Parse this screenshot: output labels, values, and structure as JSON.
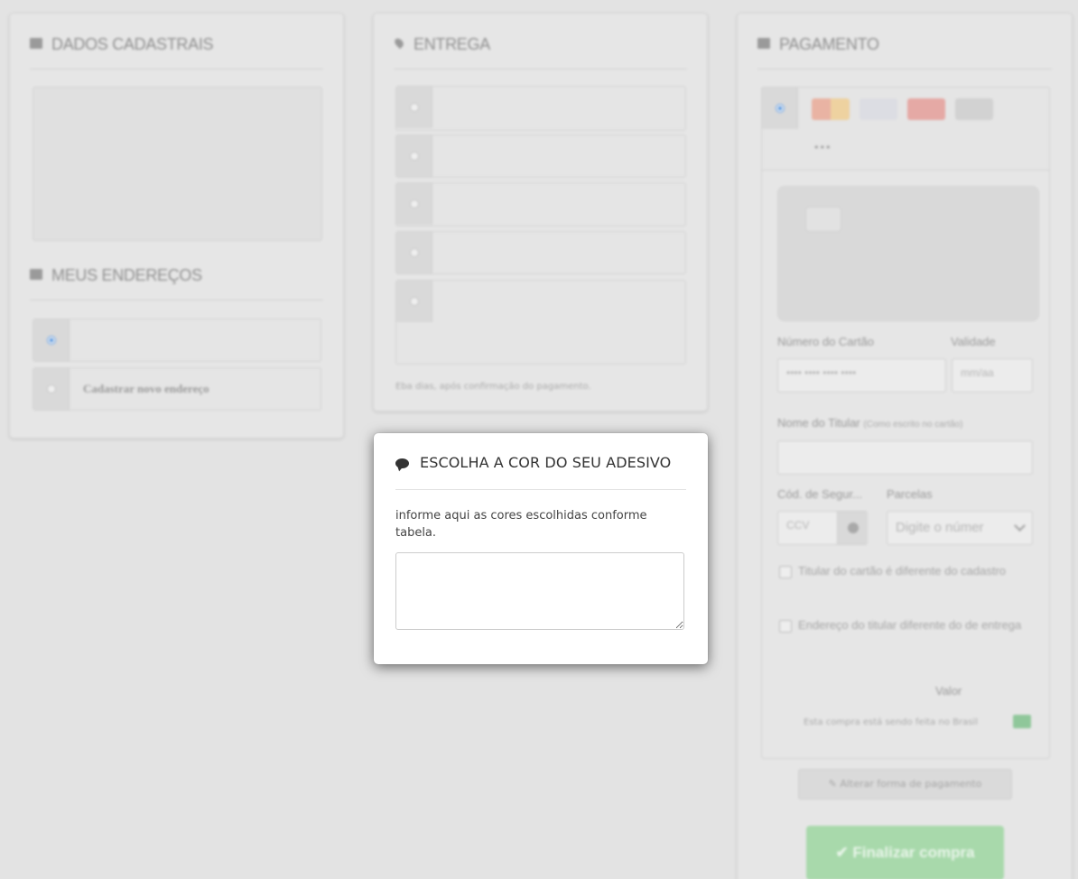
{
  "dados": {
    "title": "DADOS CADASTRAIS",
    "enderecos_title": "MEUS ENDEREÇOS",
    "new_address_label": "Cadastrar novo endereço"
  },
  "entrega": {
    "title": "ENTREGA",
    "options_count": 5,
    "note": "Eba dias, após confirmação do pagamento."
  },
  "pagamento": {
    "title": "PAGAMENTO",
    "brands": [
      "mastercard-icon",
      "visa-icon",
      "amex-icon",
      "diners-icon"
    ],
    "more_label": "•••",
    "card_number_label": "Número do Cartão",
    "card_number_placeholder": "•••• •••• •••• ••••",
    "validity_label": "Validade",
    "validity_placeholder": "mm/aa",
    "holder_label": "Nome do Titular",
    "holder_hint": "(Como escrito no cartão)",
    "cvv_label": "Cód. de Segur...",
    "cvv_placeholder": "CCV",
    "installments_label": "Parcelas",
    "installments_value": "Digite o númer",
    "check_holder_label": "Titular do cartão é diferente do cadastro",
    "check_address_label": "Endereço do titular diferente do de entrega",
    "value_label": "Valor",
    "brazil_note": "Esta compra está sendo feita no Brasil",
    "change_payment_label": "Alterar forma de pagamento",
    "finish_label": "Finalizar compra"
  },
  "modal": {
    "title": "ESCOLHA A COR DO SEU ADESIVO",
    "text": "informe aqui as cores escolhidas conforme tabela.",
    "textarea_value": ""
  },
  "colors": {
    "finish_green": "#a5d8a9",
    "radio_blue": "#4a90e2",
    "overlay_bg": "#e3e3e3"
  }
}
